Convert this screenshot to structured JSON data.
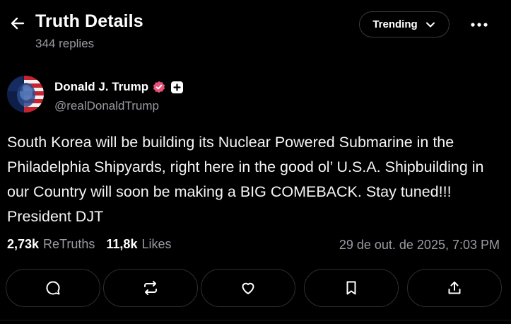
{
  "header": {
    "title": "Truth Details",
    "replies": "344 replies",
    "sort_label": "Trending"
  },
  "post": {
    "author_name": "Donald J. Trump",
    "handle": "@realDonaldTrump",
    "text": "South Korea will be building its Nuclear Powered Submarine in the Philadelphia Shipyards, right here in the good ol’ U.S.A. Shipbuilding in our Country will soon be making a BIG COMEBACK. Stay tuned!!! President DJT",
    "retruths_count": "2,73k",
    "retruths_label": "ReTruths",
    "likes_count": "11,8k",
    "likes_label": "Likes",
    "timestamp": "29 de out. de 2025, 7:03 PM"
  },
  "colors": {
    "background": "#000000",
    "muted_text": "#9a9aa3",
    "verified_badge": "#e8517a",
    "border": "#2e2e34"
  },
  "icons": {
    "back": "arrow-left-icon",
    "sort": "chevron-down-icon",
    "more": "ellipsis-icon",
    "verified": "verified-badge-icon",
    "plus": "plus-badge-icon",
    "reply": "comment-icon",
    "retruth": "retruth-icon",
    "like": "heart-icon",
    "bookmark": "bookmark-icon",
    "share": "share-icon"
  }
}
